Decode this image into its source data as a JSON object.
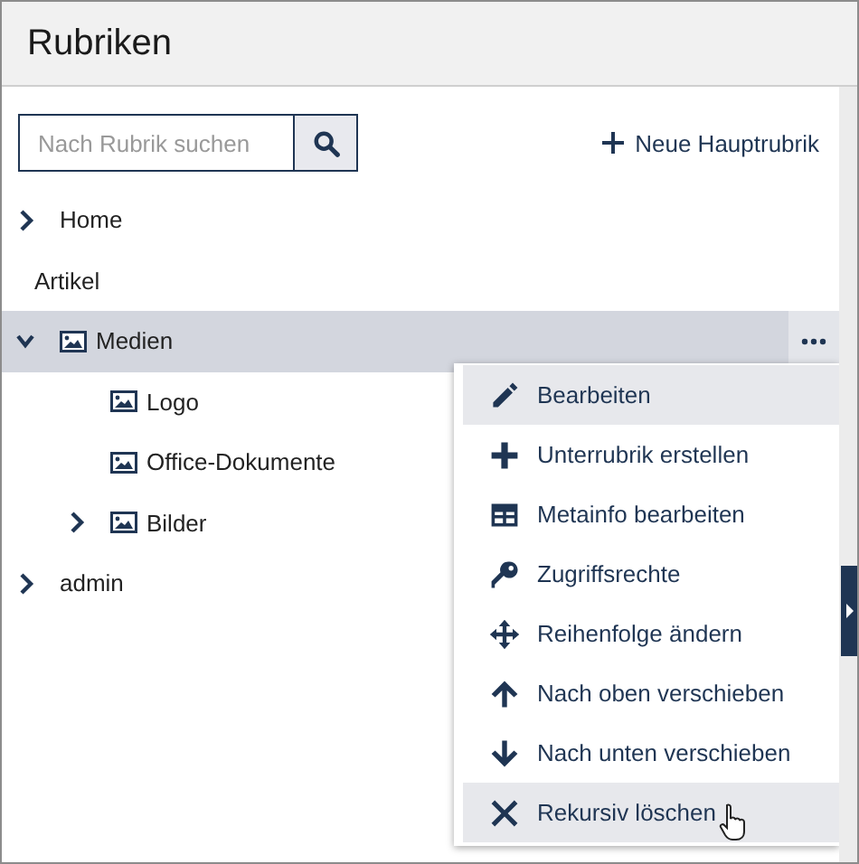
{
  "panel": {
    "title": "Rubriken"
  },
  "search": {
    "placeholder": "Nach Rubrik suchen"
  },
  "new_button": {
    "label": "Neue Hauptrubrik"
  },
  "tree": [
    {
      "label": "Home",
      "kind": "category",
      "expanded": false,
      "selected": false
    },
    {
      "label": "Artikel",
      "kind": "plain",
      "selected": false
    },
    {
      "label": "Medien",
      "kind": "picture-category",
      "expanded": true,
      "selected": true,
      "children": [
        {
          "label": "Logo",
          "kind": "picture-category",
          "selected": false
        },
        {
          "label": "Office-Dokumente",
          "kind": "picture-category",
          "selected": false
        },
        {
          "label": "Bilder",
          "kind": "picture-category",
          "expanded": false,
          "selected": false
        }
      ]
    },
    {
      "label": "admin",
      "kind": "category",
      "expanded": false,
      "selected": false
    }
  ],
  "context_menu": [
    {
      "label": "Bearbeiten",
      "kind": "edit",
      "highlighted": true
    },
    {
      "label": "Unterrubrik erstellen",
      "kind": "add",
      "highlighted": false
    },
    {
      "label": "Metainfo bearbeiten",
      "kind": "table",
      "highlighted": false
    },
    {
      "label": "Zugriffsrechte",
      "kind": "key",
      "highlighted": false
    },
    {
      "label": "Reihenfolge ändern",
      "kind": "move",
      "highlighted": false
    },
    {
      "label": "Nach oben verschieben",
      "kind": "up",
      "highlighted": false
    },
    {
      "label": "Nach unten verschieben",
      "kind": "down",
      "highlighted": false
    },
    {
      "label": "Rekursiv löschen",
      "kind": "delete",
      "highlighted": true
    }
  ]
}
